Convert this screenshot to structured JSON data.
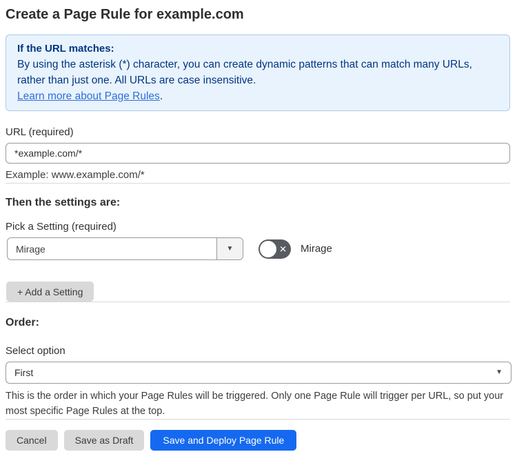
{
  "page": {
    "title": "Create a Page Rule for example.com"
  },
  "info_box": {
    "heading": "If the URL matches:",
    "body_lines": [
      "By using the asterisk (*) character, you can create dynamic patterns that can match many URLs,",
      "rather than just one. All URLs are case insensitive."
    ],
    "link_text": "Learn more about Page Rules",
    "link_suffix": "."
  },
  "url_field": {
    "label": "URL (required)",
    "value": "*example.com/*",
    "example": "Example: www.example.com/*"
  },
  "settings": {
    "heading": "Then the settings are:",
    "pick_label": "Pick a Setting (required)",
    "selected_value": "Mirage",
    "toggle_label": "Mirage",
    "toggle_state": "off",
    "add_button_label": "+ Add a Setting"
  },
  "order": {
    "heading": "Order:",
    "label": "Select option",
    "selected_value": "First",
    "help_lines": [
      "This is the order in which your Page Rules will be triggered. Only one Page Rule will trigger per URL, so put your",
      "most specific Page Rules at the top."
    ]
  },
  "footer": {
    "cancel_label": "Cancel",
    "save_draft_label": "Save as Draft",
    "save_deploy_label": "Save and Deploy Page Rule"
  },
  "icons": {
    "dropdown_arrow": "▼",
    "toggle_off_glyph": "✕"
  },
  "colors": {
    "accent_blue": "#1569f0",
    "info_background": "#e9f3fd",
    "info_border": "#abc9e9",
    "info_text": "#003682",
    "link_blue": "#2f6fd6",
    "toggle_off_gray": "#585c61",
    "button_gray": "#d9d9d9"
  }
}
